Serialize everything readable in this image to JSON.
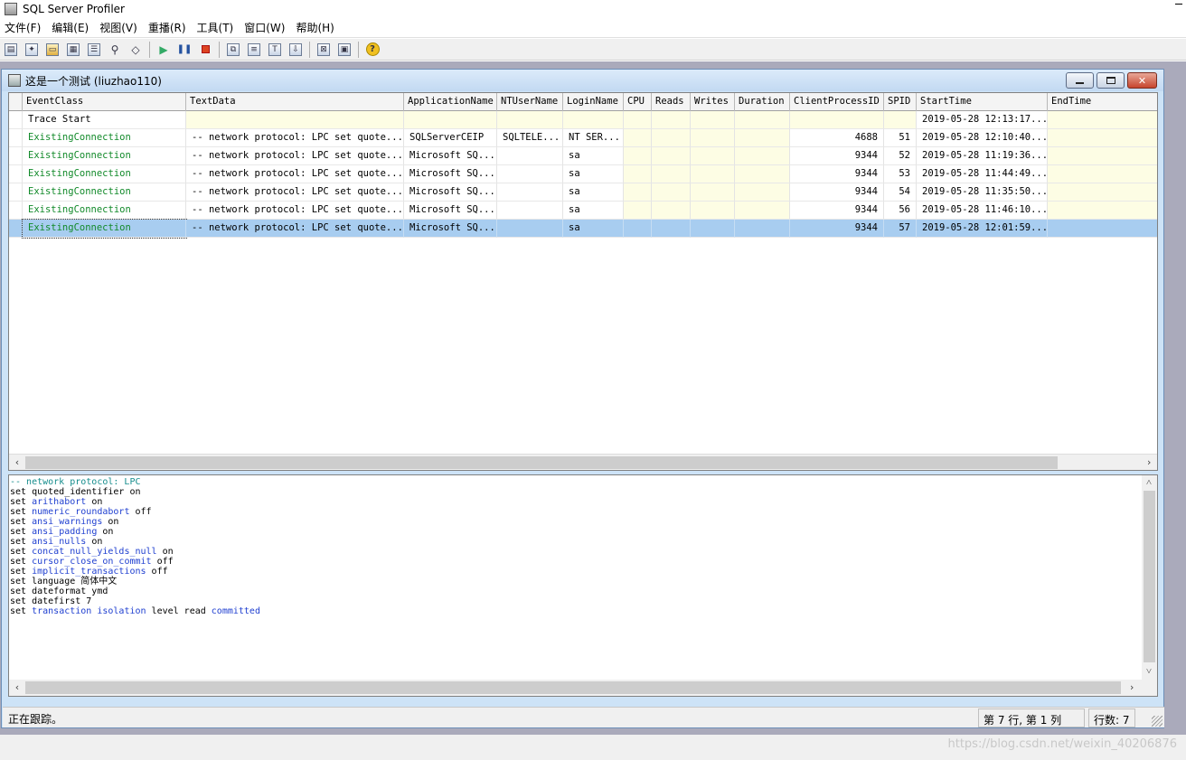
{
  "window": {
    "title": "SQL Server Profiler"
  },
  "menu": [
    "文件(F)",
    "编辑(E)",
    "视图(V)",
    "重播(R)",
    "工具(T)",
    "窗口(W)",
    "帮助(H)"
  ],
  "toolbar": {
    "icons": [
      "new-trace-icon",
      "new-template-icon",
      "open-icon",
      "save-icon",
      "properties-icon",
      "find-icon",
      "clear-icon",
      "run-icon",
      "pause-icon",
      "stop-icon",
      "group-icon",
      "aggregate-icon",
      "column-icon",
      "autoscroll-icon",
      "perfmon-icon",
      "tuning-icon",
      "help-icon"
    ]
  },
  "trace": {
    "title": "这是一个测试 (liuzhao110)",
    "columns": [
      "EventClass",
      "TextData",
      "ApplicationName",
      "NTUserName",
      "LoginName",
      "CPU",
      "Reads",
      "Writes",
      "Duration",
      "ClientProcessID",
      "SPID",
      "StartTime",
      "EndTime"
    ],
    "rows": [
      [
        "Trace Start",
        "",
        "",
        "",
        "",
        "",
        "",
        "",
        "",
        "",
        "",
        "2019-05-28 12:13:17...",
        ""
      ],
      [
        "ExistingConnection",
        "-- network protocol: LPC  set quote...",
        "SQLServerCEIP",
        "SQLTELE...",
        "NT SER...",
        "",
        "",
        "",
        "",
        "4688",
        "51",
        "2019-05-28 12:10:40...",
        ""
      ],
      [
        "ExistingConnection",
        "-- network protocol: LPC  set quote...",
        "Microsoft SQ...",
        "",
        "sa",
        "",
        "",
        "",
        "",
        "9344",
        "52",
        "2019-05-28 11:19:36...",
        ""
      ],
      [
        "ExistingConnection",
        "-- network protocol: LPC  set quote...",
        "Microsoft SQ...",
        "",
        "sa",
        "",
        "",
        "",
        "",
        "9344",
        "53",
        "2019-05-28 11:44:49...",
        ""
      ],
      [
        "ExistingConnection",
        "-- network protocol: LPC  set quote...",
        "Microsoft SQ...",
        "",
        "sa",
        "",
        "",
        "",
        "",
        "9344",
        "54",
        "2019-05-28 11:35:50...",
        ""
      ],
      [
        "ExistingConnection",
        "-- network protocol: LPC  set quote...",
        "Microsoft SQ...",
        "",
        "sa",
        "",
        "",
        "",
        "",
        "9344",
        "56",
        "2019-05-28 11:46:10...",
        ""
      ],
      [
        "ExistingConnection",
        "-- network protocol: LPC  set quote...",
        "Microsoft SQ...",
        "",
        "sa",
        "",
        "",
        "",
        "",
        "9344",
        "57",
        "2019-05-28 12:01:59...",
        ""
      ]
    ],
    "selected_row": 6
  },
  "textdata": {
    "lines": [
      [
        [
          "cm",
          "-- network protocol: LPC"
        ]
      ],
      [
        [
          "",
          "set quoted_identifier on"
        ]
      ],
      [
        [
          "",
          "set "
        ],
        [
          "kw",
          "arithabort"
        ],
        [
          "",
          " on"
        ]
      ],
      [
        [
          "",
          "set "
        ],
        [
          "kw",
          "numeric_roundabort"
        ],
        [
          "",
          " off"
        ]
      ],
      [
        [
          "",
          "set "
        ],
        [
          "kw",
          "ansi_warnings"
        ],
        [
          "",
          " on"
        ]
      ],
      [
        [
          "",
          "set "
        ],
        [
          "kw",
          "ansi_padding"
        ],
        [
          "",
          " on"
        ]
      ],
      [
        [
          "",
          "set "
        ],
        [
          "kw",
          "ansi_nulls"
        ],
        [
          "",
          " on"
        ]
      ],
      [
        [
          "",
          "set "
        ],
        [
          "kw",
          "concat_null_yields_null"
        ],
        [
          "",
          " on"
        ]
      ],
      [
        [
          "",
          "set "
        ],
        [
          "kw",
          "cursor_close_on_commit"
        ],
        [
          "",
          " off"
        ]
      ],
      [
        [
          "",
          "set "
        ],
        [
          "kw",
          "implicit_transactions"
        ],
        [
          "",
          " off"
        ]
      ],
      [
        [
          "",
          "set language 简体中文"
        ]
      ],
      [
        [
          "",
          "set dateformat ymd"
        ]
      ],
      [
        [
          "",
          "set datefirst 7"
        ]
      ],
      [
        [
          "",
          "set "
        ],
        [
          "kw",
          "transaction isolation"
        ],
        [
          "",
          " level read "
        ],
        [
          "kw",
          "committed"
        ]
      ]
    ]
  },
  "status": {
    "message": "正在跟踪。",
    "position": "第 7 行, 第 1 列",
    "rowcount": "行数: 7"
  },
  "watermark": "https://blog.csdn.net/weixin_40206876"
}
